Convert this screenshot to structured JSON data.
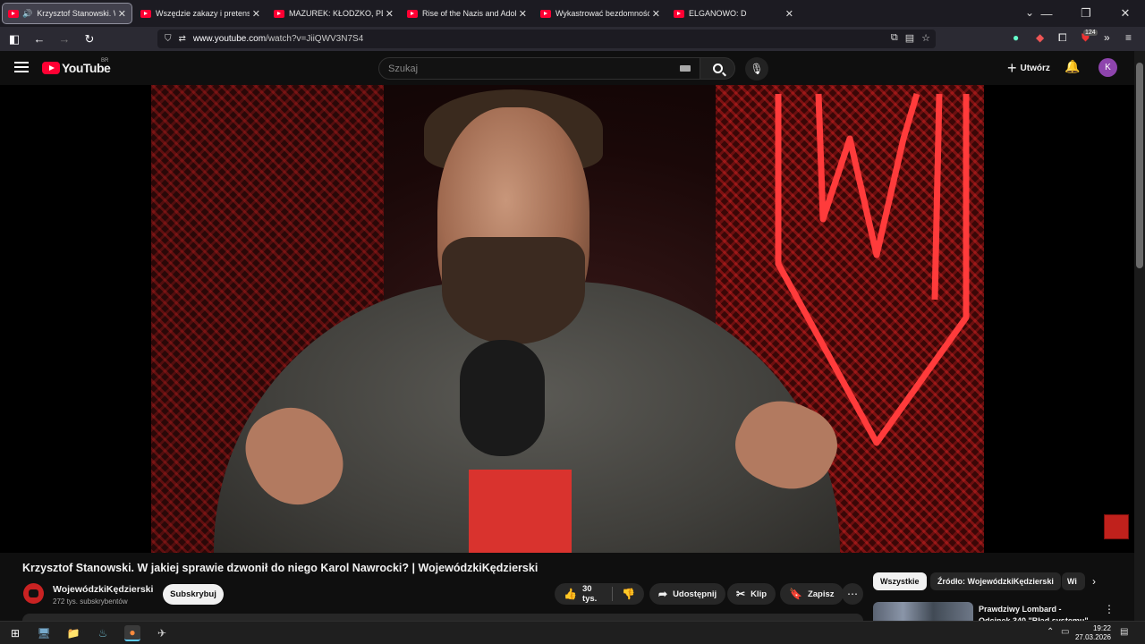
{
  "browser": {
    "tabs": [
      {
        "title": "Krzysztof Stanowski. W jaki",
        "active": true,
        "audio": true
      },
      {
        "title": "Wszędzie zakazy i pretensje! Lu",
        "active": false
      },
      {
        "title": "MAZUREK: KŁODZKO, PEDOFILI",
        "active": false
      },
      {
        "title": "Rise of the Nazis and Adolf Hitl",
        "active": false
      },
      {
        "title": "Wykastrować bezdomność! Ust",
        "active": false
      },
      {
        "title": "ELGANOWO: D",
        "active": false
      }
    ],
    "url_host": "www.youtube.com",
    "url_path": "/watch?v=JiiQWV3N7S4",
    "ext_badge": "124"
  },
  "youtube": {
    "logo_text": "YouTube",
    "country_code": "BR",
    "search_placeholder": "Szukaj",
    "create_label": "Utwórz",
    "avatar_letter": "K"
  },
  "video": {
    "title": "Krzysztof Stanowski. W jakiej sprawie dzwonił do niego Karol Nawrocki? | WojewódzkiKędzierski",
    "channel_name": "WojewódzkiKędzierski",
    "subscribers": "272 tys. subskrybentów",
    "subscribe_label": "Subskrybuj",
    "likes": "30 tys.",
    "share_label": "Udostępnij",
    "clip_label": "Klip",
    "save_label": "Zapisz"
  },
  "sidebar": {
    "chips": [
      "Wszystkie",
      "Źródło: WojewódzkiKędzierski",
      "Wi"
    ],
    "rec_title": "Prawdziwy Lombard - Odcinek 340 \"Błąd systemu\""
  },
  "taskbar": {
    "time": "19:22",
    "date": "27.03.2026"
  },
  "colors": {
    "yt_red": "#ff0033",
    "avatar": "#8e44ad"
  }
}
